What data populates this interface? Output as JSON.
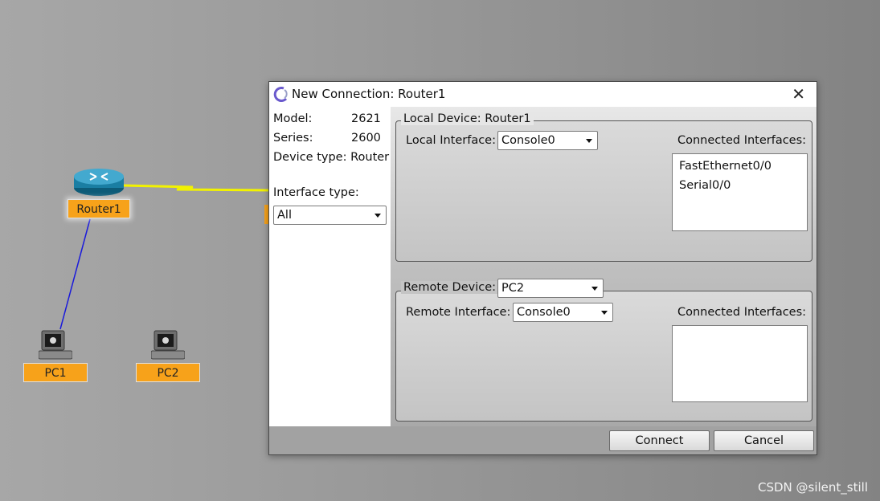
{
  "canvas": {
    "devices": [
      {
        "label": "Router1",
        "kind": "router-icon"
      },
      {
        "label": "PC1",
        "kind": "pc-icon"
      },
      {
        "label": "PC2",
        "kind": "pc-icon"
      }
    ],
    "watermark": "CSDN @silent_still"
  },
  "dialog": {
    "title": "New Connection: Router1",
    "close_glyph": "✕",
    "info": {
      "model_label": "Model:",
      "model_value": "2621",
      "series_label": "Series:",
      "series_value": "2600",
      "device_type": "Device type: Router"
    },
    "interface_type_label": "Interface type:",
    "interface_type_value": "All",
    "local": {
      "group_title": "Local Device: Router1",
      "interface_label": "Local Interface:",
      "interface_value": "Console0",
      "connected_label": "Connected Interfaces:",
      "connected_items": [
        "FastEthernet0/0",
        "Serial0/0"
      ]
    },
    "remote": {
      "group_title": "Remote Device:",
      "device_value": "PC2",
      "interface_label": "Remote Interface:",
      "interface_value": "Console0",
      "connected_label": "Connected Interfaces:",
      "connected_items": []
    },
    "buttons": {
      "connect": "Connect",
      "cancel": "Cancel"
    }
  },
  "colors": {
    "device_label_bg": "#f7a21a",
    "serial_link": "#f2f200",
    "ethernet_link": "#1a1adb"
  }
}
